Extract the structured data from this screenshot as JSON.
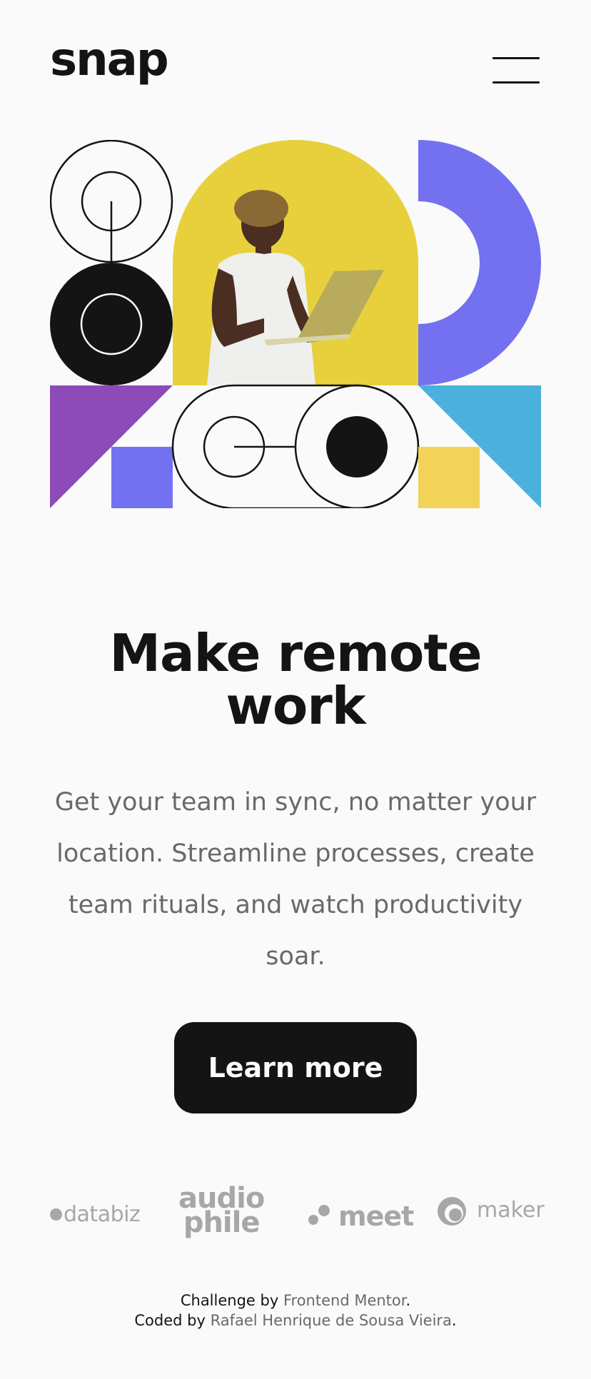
{
  "header": {
    "logo": "snap",
    "menu_icon": "hamburger-menu-icon"
  },
  "colors": {
    "background": "#fafafa",
    "text_dark": "#141414",
    "text_gray": "#696969",
    "yellow": "#e8d03d",
    "purple": "#7471f0",
    "violet": "#8d4bb8",
    "sky": "#4cb0dc",
    "soft_yellow": "#f1d359"
  },
  "hero": {
    "photo_alt": "Person holding a laptop"
  },
  "main": {
    "headline_line1": "Make remote",
    "headline_line2": "work",
    "lead": "Get your team in sync, no matter your location. Streamline processes, create team rituals, and watch productivity soar.",
    "cta_label": "Learn more"
  },
  "clients": {
    "databiz": "databiz",
    "audiophile_line1": "audio",
    "audiophile_line2": "phile",
    "meet": "meet",
    "maker": "maker"
  },
  "attribution": {
    "challenge_prefix": "Challenge by",
    "challenge_link": "Frontend Mentor",
    "challenge_suffix": ".",
    "coded_prefix": "Coded by",
    "coded_link": "Rafael Henrique de Sousa Vieira",
    "coded_suffix": "."
  }
}
